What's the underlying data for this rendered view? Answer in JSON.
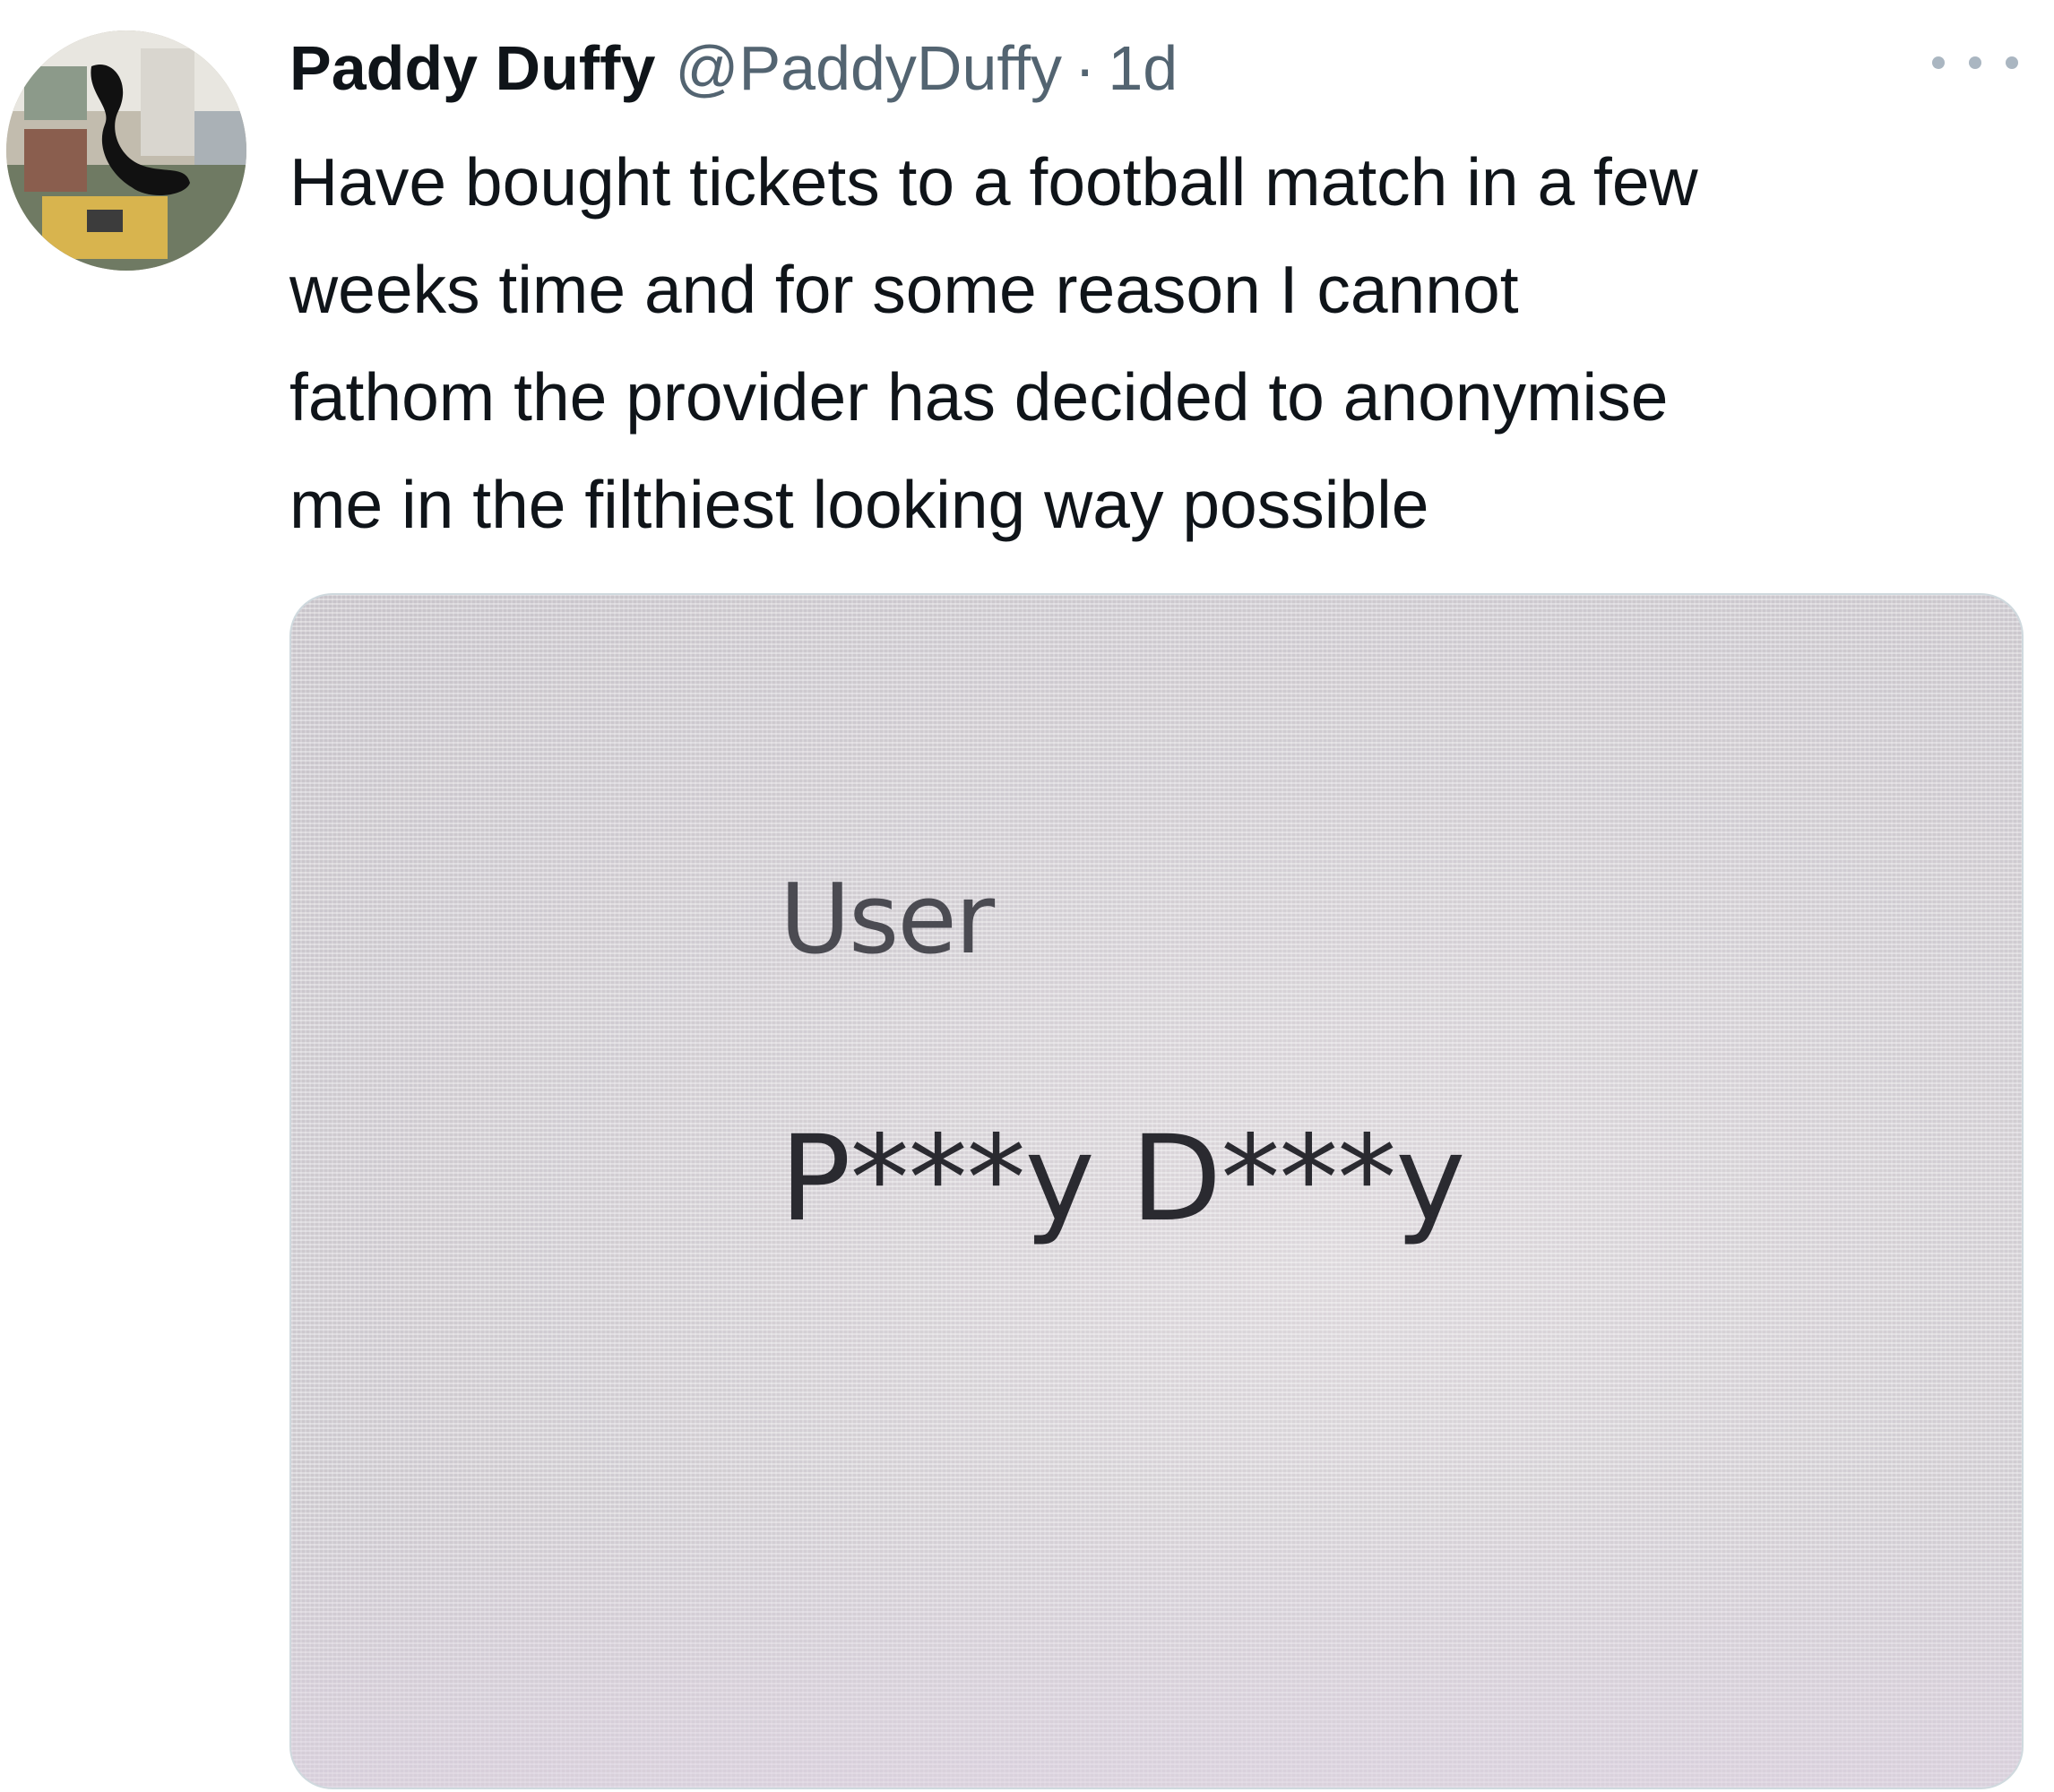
{
  "tweet": {
    "display_name": "Paddy Duffy",
    "handle": "@PaddyDuffy",
    "separator": "·",
    "time": "1d",
    "more_icon": "more-dots-icon",
    "text": "Have bought tickets to a football match in a few\nweeks time and for some reason I cannot\nfathom the provider has decided to anonymise\nme in the filthiest looking way possible",
    "avatar_icon": "avatar-photo"
  },
  "media": {
    "label": "User",
    "value": "P***y D***y"
  },
  "colors": {
    "text_primary": "#0f1419",
    "text_secondary": "#536471",
    "border": "#cfd9de"
  }
}
